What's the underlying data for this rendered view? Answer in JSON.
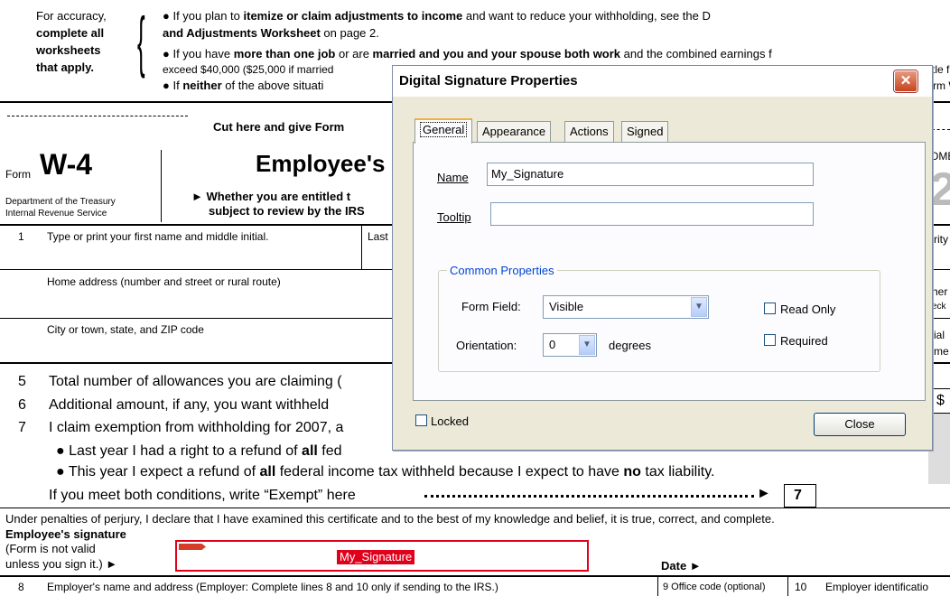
{
  "form": {
    "accuracy": [
      "For accuracy,",
      "complete all",
      "worksheets",
      "that apply."
    ],
    "bullet1_a": "● If you plan to ",
    "bullet1_b": "itemize or claim adjustments to income",
    "bullet1_c": " and want to reduce your withholding, see the D",
    "bullet1_line2_b": "and Adjustments Worksheet",
    "bullet1_line2_c": " on page 2.",
    "bullet2_a": "● If you have ",
    "bullet2_b": "more than one job",
    "bullet2_c": " or are ",
    "bullet2_d": "married and you and your spouse both work",
    "bullet2_e": " and the combined earnings f",
    "bullet2_line2": "exceed $40,000 ($25,000 if married",
    "bullet2_line2_right": "tle f",
    "bullet3_a": "● If ",
    "bullet3_b": "neither",
    "bullet3_c": " of the above situati",
    "bullet3_right": "rm W",
    "cut_here": "Cut here and give Form",
    "form_label": "Form",
    "form_number": "W-4",
    "form_title": "Employee's",
    "omb": "OMB",
    "year_digit": "2",
    "dept1": "Department of the Treasury",
    "dept2": "Internal Revenue Service",
    "whether1": "► Whether you are entitled t",
    "whether2": "subject to review by the IRS",
    "line1_num": "1",
    "line1_text": "Type or print your first name and middle initial.",
    "line1_last": "Last",
    "line1_right": "rity",
    "home_address": "Home address (number and street or rural route)",
    "right_her": "her",
    "right_eck": "eck",
    "city": "City or town, state, and ZIP code",
    "right_ial": "ial",
    "right_me": "me",
    "line5_num": "5",
    "line5_text": "Total number of allowances you are claiming (",
    "line6_num": "6",
    "line6_text": "Additional amount, if any, you want withheld",
    "line6_dollar": "$",
    "line7_num": "7",
    "line7_text": "I claim exemption from withholding for 2007, a",
    "line7_b1_a": "● Last year I had a right to a refund of ",
    "line7_b1_b": "all",
    "line7_b1_c": " fed",
    "line7_b2_a": "● This year I expect a refund of ",
    "line7_b2_b": "all",
    "line7_b2_c": " federal income tax withheld because I expect to have ",
    "line7_b2_d": "no",
    "line7_b2_e": " tax liability.",
    "line7_exempt": "If you meet both conditions, write “Exempt” here",
    "line7_box": "7",
    "perjury": "Under penalties of perjury, I declare that I have examined this certificate and to the best of my knowledge and belief, it is true, correct, and complete.",
    "emp_sig": "Employee's signature",
    "not_valid1": "(Form is not valid",
    "not_valid2": "unless you sign it.) ►",
    "date": "Date ►",
    "line8_num": "8",
    "line8_text": "Employer's name and address (Employer: Complete lines 8 and 10 only if sending to the IRS.)",
    "line9_text": "9 Office code (optional)",
    "line10_num": "10",
    "line10_text": "Employer identificatio",
    "signature_field_value": "My_Signature"
  },
  "dialog": {
    "title": "Digital Signature Properties",
    "tabs": [
      "General",
      "Appearance",
      "Actions",
      "Signed"
    ],
    "active_tab": "General",
    "name_label": "Name",
    "name_value": "My_Signature",
    "tooltip_label": "Tooltip",
    "tooltip_value": "",
    "group_title": "Common Properties",
    "form_field_label": "Form Field:",
    "form_field_value": "Visible",
    "orientation_label": "Orientation:",
    "orientation_value": "0",
    "degrees_label": "degrees",
    "read_only_label": "Read Only",
    "required_label": "Required",
    "locked_label": "Locked",
    "close_label": "Close",
    "read_only_checked": false,
    "required_checked": false,
    "locked_checked": false
  }
}
